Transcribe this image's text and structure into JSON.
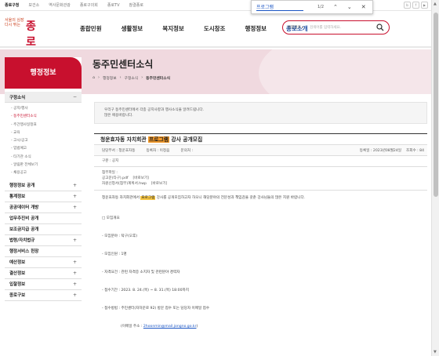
{
  "topbar": {
    "links": [
      "종로구청",
      "보건소",
      "역사문화관광",
      "종로구의회",
      "종로TV",
      "참결종로"
    ]
  },
  "findbar": {
    "query": "프로그램",
    "count": "1/2"
  },
  "logo": {
    "small_line1": "서울의 심장",
    "small_line2": "다시 뛰는",
    "big": "종로"
  },
  "gnb": {
    "items": [
      "종합민원",
      "생활정보",
      "복지정보",
      "도시창조",
      "행정정보",
      "종로소개"
    ]
  },
  "search": {
    "scope": "통합검색",
    "placeholder": "검색어를 입력하세요."
  },
  "banner": {
    "title": "동주민센터소식",
    "crumbs": [
      "행정정보",
      "구정소식",
      "동주민센터소식"
    ]
  },
  "lnb": {
    "head": "행정정보",
    "open_section": "구정소식",
    "sub_items": [
      "공지/행사",
      "동주민센터소식",
      "주간행사일정표",
      "교육",
      "고시/공고",
      "입법예고",
      "타기관 소식",
      "알림판 전체보기",
      "채용공고"
    ],
    "sections": [
      "행정정보 공개",
      "통계정보",
      "공공데이터 개방",
      "업무추진비 공개",
      "보조금지급 공개",
      "법령/자치법규",
      "행정서비스 헌장",
      "예산정보",
      "결산정보",
      "입찰정보",
      "종로구보"
    ]
  },
  "content": {
    "notice_line1": "우리구 동주민센터에서 각종 공지사항과 행사소식을 알려드립니다.",
    "notice_line2": "많은 애용바랍니다.",
    "post_title_pre": "청운효자동 자치회관 ",
    "post_title_mark": "프로그램",
    "post_title_post": " 강사 공개모집",
    "meta_dept": "담당부서 : 청운효자동",
    "meta_author": "등록자 : 이정음",
    "meta_phone": "문의처 :",
    "meta_date": "등록일 : 2023년08월24일",
    "meta_views": "조회수 : 84",
    "category": "구분 : 공지",
    "files_label": "첨부파일 :",
    "file1": "공고문(타구).pdf",
    "file1_action": "[바로보기]",
    "file2": "자원신청서(첨부)계획서.hwp",
    "file2_action": "[바로보기]",
    "body_lead_pre": "청운효자동 자치회관에서 ",
    "body_lead_mark": "프로그램",
    "body_lead_post": " 강사를 공개모집하고자 하오니 해당분야의 전문성과 책임감을 갖춘 강사님들의 많은 지원 바랍니다.",
    "lines": [
      "□ 모집개요",
      " - 모집분야 : 탁구(오후)",
      " - 모집인원 : 1명",
      " - 자격요건 : 관련 자격증 소지자 및 관련분야 경력자",
      " - 접수기간 : 2023. 8. 24.(목) ~ 8. 31.(목) 18:00까지",
      " - 접수방법 : 주민센터(자하문로 92) 방문 접수 또는 담당자 이메일 접수"
    ],
    "email_label": "(이메일 주소 : ",
    "email": "2hoonmin@mail.jongno.go.kr",
    "email_close": ")"
  }
}
